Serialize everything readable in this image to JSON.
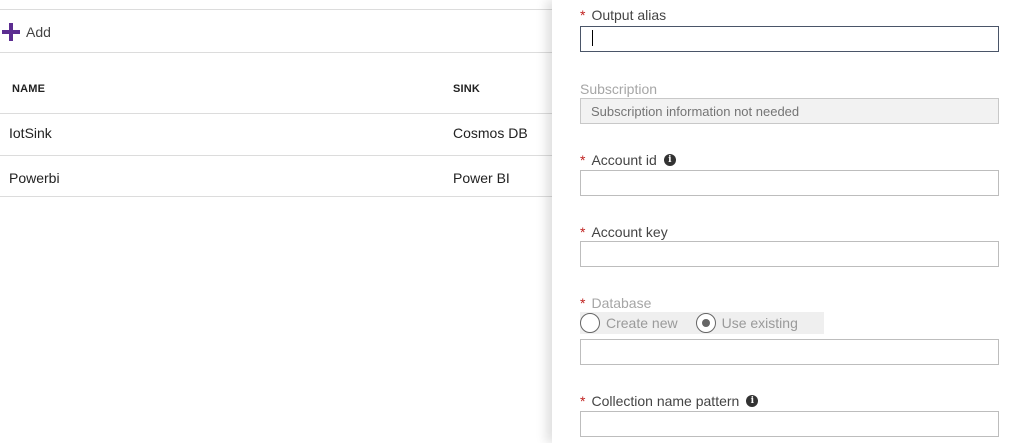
{
  "list": {
    "add_label": "Add",
    "columns": {
      "name": "NAME",
      "sink": "SINK"
    },
    "rows": [
      {
        "name": "IotSink",
        "sink": "Cosmos DB"
      },
      {
        "name": "Powerbi",
        "sink": "Power BI"
      }
    ]
  },
  "form": {
    "required_mark": "*",
    "output_alias": {
      "label": "Output alias",
      "value": ""
    },
    "subscription": {
      "label": "Subscription",
      "placeholder": "Subscription information not needed"
    },
    "account_id": {
      "label": "Account id",
      "value": ""
    },
    "account_key": {
      "label": "Account key",
      "value": ""
    },
    "database": {
      "label": "Database",
      "option_new": "Create new",
      "option_existing": "Use existing",
      "selected": "Use existing",
      "value": ""
    },
    "collection_pattern": {
      "label": "Collection name pattern",
      "value": ""
    },
    "info_glyph": "i"
  },
  "colors": {
    "accent": "#5c2d91",
    "required": "#c0211f"
  }
}
